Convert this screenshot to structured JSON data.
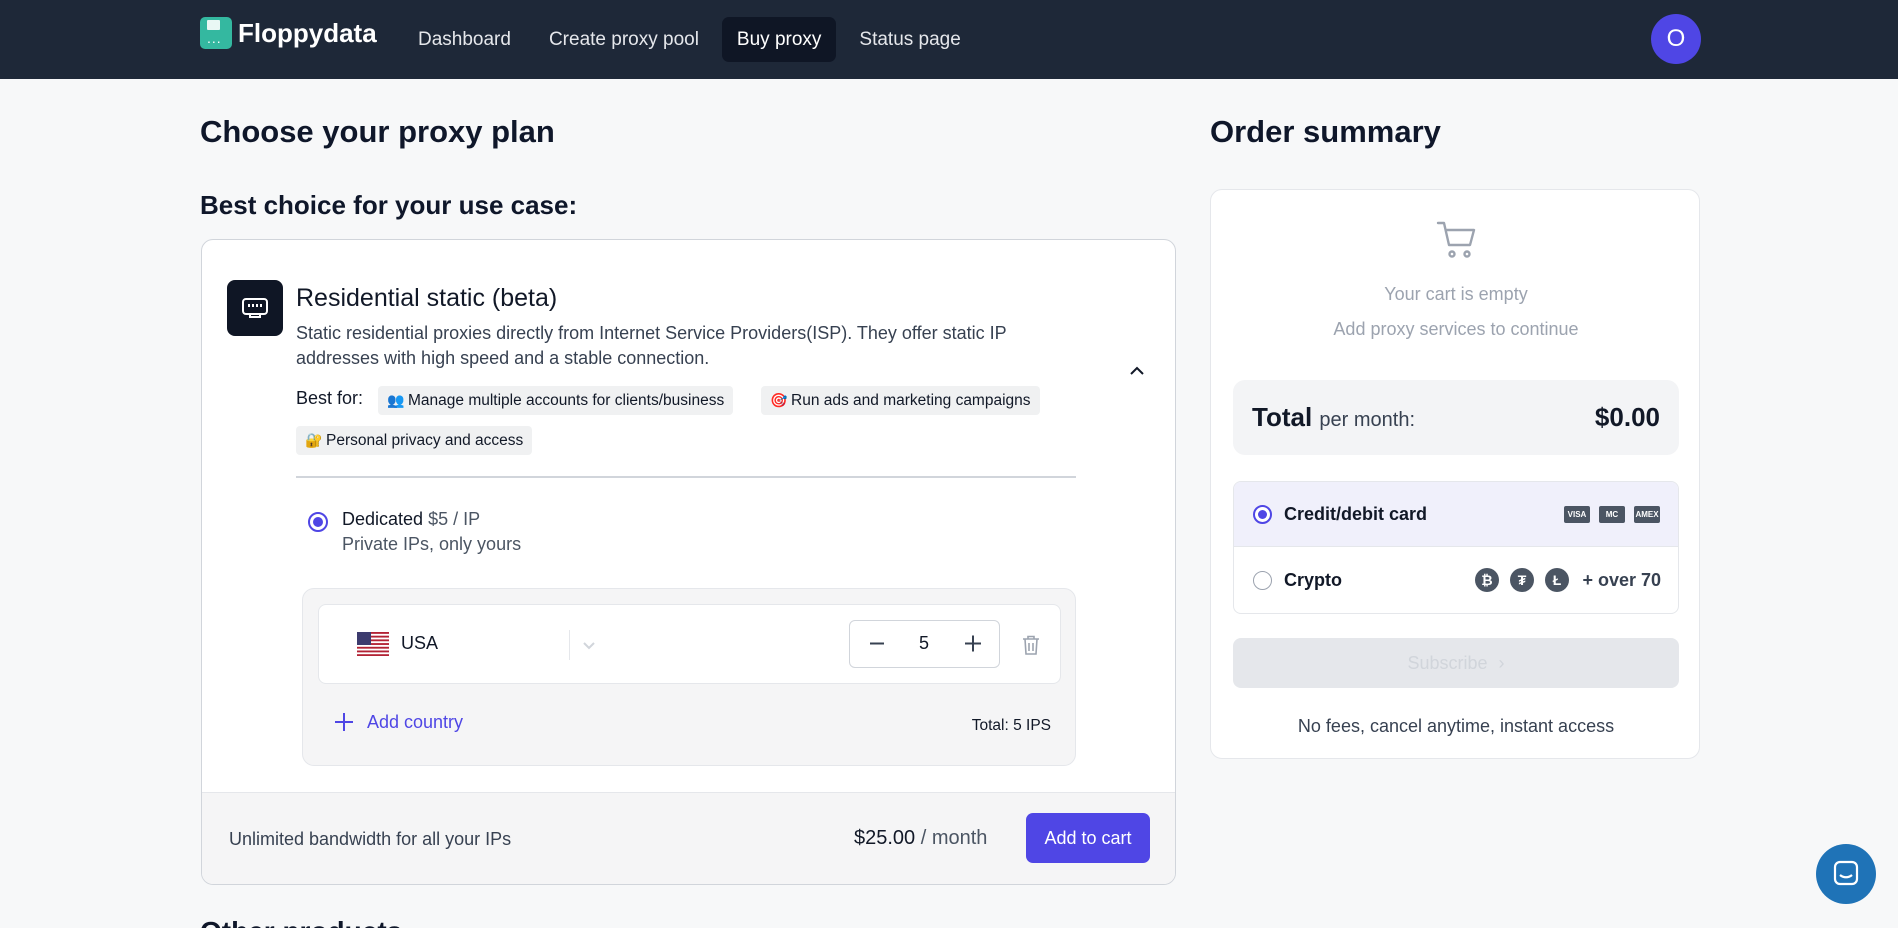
{
  "app": {
    "name": "Floppydata"
  },
  "nav": {
    "items": [
      {
        "label": "Dashboard"
      },
      {
        "label": "Create proxy pool"
      },
      {
        "label": "Buy proxy"
      },
      {
        "label": "Status page"
      }
    ],
    "active_index": 2,
    "avatar_initial": "O"
  },
  "page": {
    "title": "Choose your proxy plan",
    "subtitle": "Best choice for your use case:",
    "other_title": "Other products"
  },
  "product": {
    "title": "Residential static (beta)",
    "description": "Static residential proxies directly from Internet Service Providers(ISP). They offer static IP addresses with high speed and a stable connection.",
    "best_for_label": "Best for:",
    "tags": [
      {
        "emoji": "👥",
        "label": "Manage multiple accounts for clients/business"
      },
      {
        "emoji": "🎯",
        "label": "Run ads and marketing campaigns"
      },
      {
        "emoji": "🔐",
        "label": "Personal privacy and access"
      }
    ],
    "plan": {
      "name": "Dedicated",
      "price": "$5 / IP",
      "subtitle": "Private IPs, only yours",
      "selected": true
    },
    "countries": [
      {
        "name": "USA",
        "quantity": "5"
      }
    ],
    "add_country_label": "Add country",
    "total_ips": "Total: 5 IPS",
    "footer_note": "Unlimited bandwidth for all your IPs",
    "price": "$25.00",
    "price_period": "/ month",
    "add_to_cart_label": "Add to cart"
  },
  "summary": {
    "title": "Order summary",
    "empty_title": "Your cart is empty",
    "empty_sub": "Add proxy services to continue",
    "total_label": "Total",
    "total_per": "per month:",
    "total_value": "$0.00",
    "payment_methods": [
      {
        "label": "Credit/debit card",
        "selected": true,
        "icons": [
          "VISA",
          "MC",
          "AMEX"
        ]
      },
      {
        "label": "Crypto",
        "selected": false,
        "icons": [
          "₿",
          "₮",
          "Ł"
        ],
        "extra": "+ over 70"
      }
    ],
    "subscribe_label": "Subscribe",
    "no_fees": "No fees, cancel anytime, instant access"
  },
  "colors": {
    "nav_bg": "#1e2838",
    "accent": "#4f46e5",
    "logo": "#34b8a0",
    "chat": "#1f73b7"
  }
}
